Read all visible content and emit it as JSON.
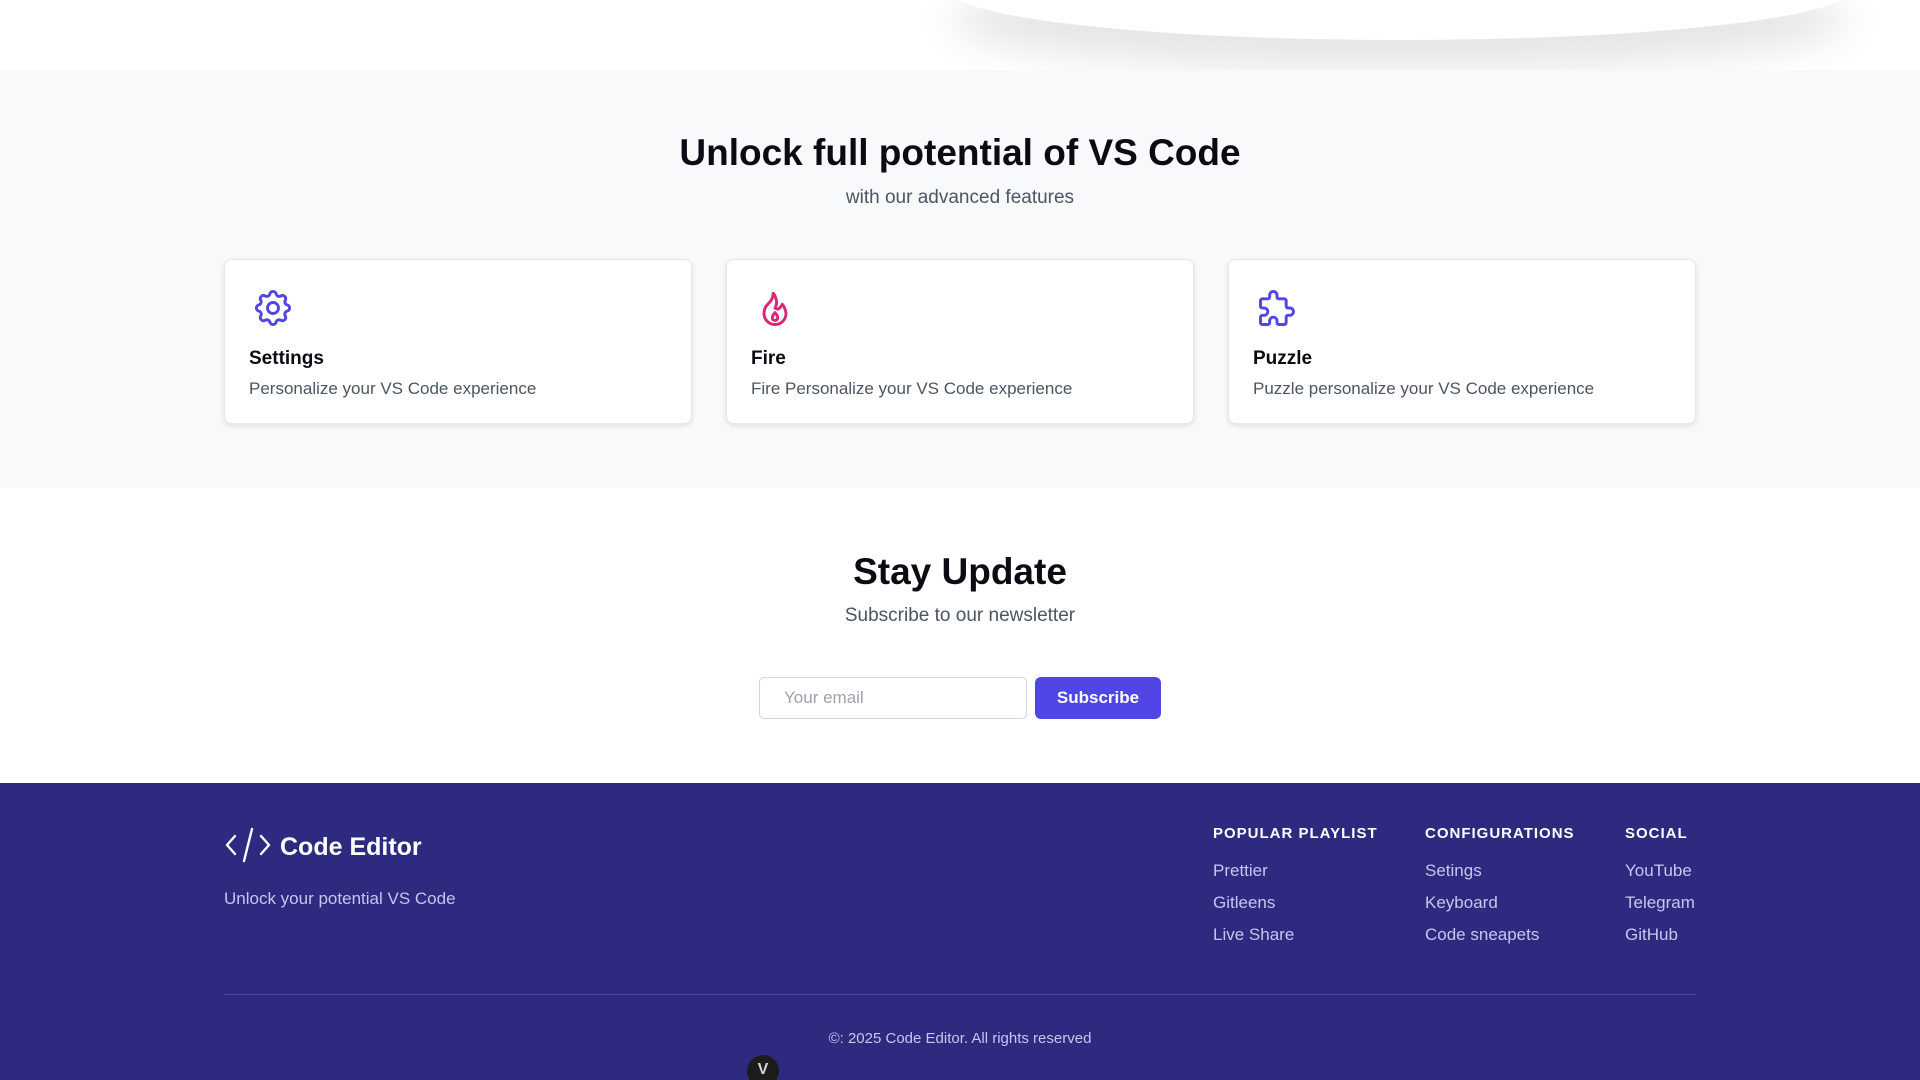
{
  "features": {
    "title": "Unlock full potential of VS Code",
    "subtitle": "with our advanced features",
    "cards": [
      {
        "icon": "settings-icon",
        "title": "Settings",
        "description": "Personalize your VS Code experience",
        "color": "#4f46e5"
      },
      {
        "icon": "fire-icon",
        "title": "Fire",
        "description": "Fire Personalize your VS Code experience",
        "color": "#db2777"
      },
      {
        "icon": "puzzle-icon",
        "title": "Puzzle",
        "description": "Puzzle personalize your VS Code experience",
        "color": "#4f46e5"
      }
    ]
  },
  "newsletter": {
    "title": "Stay Update",
    "subtitle": "Subscribe to our newsletter",
    "email_placeholder": "Your email",
    "email_value": "",
    "button_label": "Subscribe",
    "button_color": "#4f46e5"
  },
  "footer": {
    "brand_name": "Code Editor",
    "brand_icon": "code-icon",
    "tagline": "Unlock your potential VS Code",
    "background": "#2e2a7f",
    "columns": [
      {
        "heading": "POPULAR PLAYLIST",
        "links": [
          "Prettier",
          "Gitleens",
          "Live Share"
        ]
      },
      {
        "heading": "CONFIGURATIONS",
        "links": [
          "Setings",
          "Keyboard",
          "Code sneapets"
        ]
      },
      {
        "heading": "SOCIAL",
        "links": [
          "YouTube",
          "Telegram",
          "GitHub"
        ]
      }
    ],
    "copyright": "©: 2025 Code Editor. All rights reserved",
    "badge": "V"
  }
}
